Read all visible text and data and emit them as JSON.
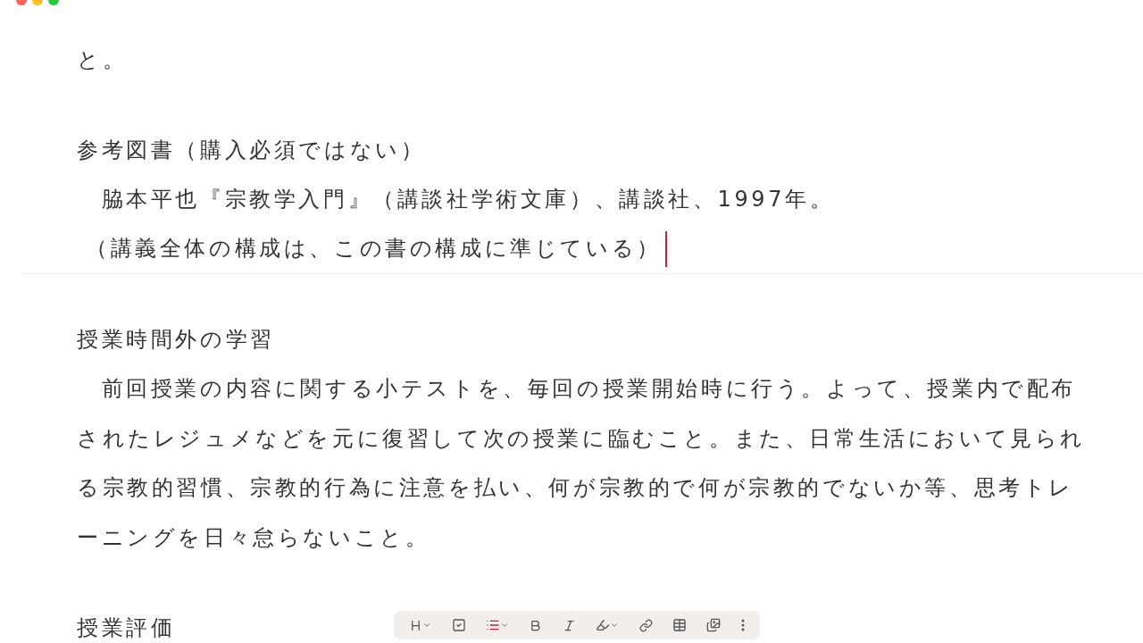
{
  "document": {
    "blocks": [
      {
        "kind": "text",
        "text": "と。"
      },
      {
        "kind": "gap"
      },
      {
        "kind": "heading",
        "text": "参考図書（購入必須ではない）"
      },
      {
        "kind": "text",
        "text": "　脇本平也『宗教学入門』（講談社学術文庫）、講談社、1997年。"
      },
      {
        "kind": "note",
        "text": "（講義全体の構成は、この書の構成に準じている）",
        "cursor": true
      },
      {
        "kind": "divider"
      },
      {
        "kind": "gap"
      },
      {
        "kind": "heading",
        "text": "授業時間外の学習"
      },
      {
        "kind": "paragraph",
        "text": "　前回授業の内容に関する小テストを、毎回の授業開始時に行う。よって、授業内で配布されたレジュメなどを元に復習して次の授業に臨むこと。また、日常生活において見られる宗教的習慣、宗教的行為に注意を払い、何が宗教的で何が宗教的でないか等、思考トレーニングを日々怠らないこと。"
      },
      {
        "kind": "gap"
      },
      {
        "kind": "heading",
        "text": "授業評価"
      }
    ]
  },
  "toolbar": [
    {
      "kind": "heading"
    },
    {
      "kind": "checklist"
    },
    {
      "kind": "list"
    },
    {
      "kind": "bold"
    },
    {
      "kind": "italic"
    },
    {
      "kind": "highlight"
    },
    {
      "kind": "link"
    },
    {
      "kind": "table"
    },
    {
      "kind": "image"
    },
    {
      "kind": "more"
    }
  ]
}
